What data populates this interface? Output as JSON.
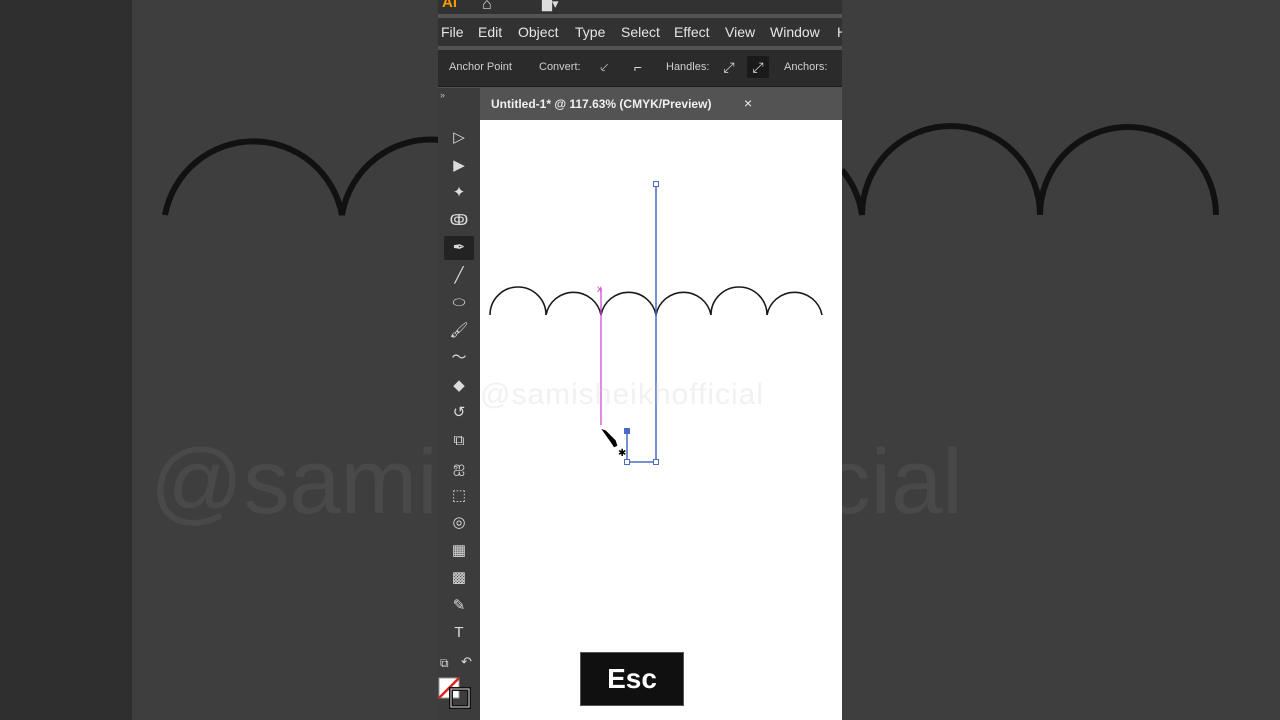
{
  "app": {
    "logo": "Ai",
    "menu": [
      "File",
      "Edit",
      "Object",
      "Type",
      "Select",
      "Effect",
      "View",
      "Window",
      "H"
    ]
  },
  "control_bar": {
    "anchor_point_label": "Anchor Point",
    "convert_label": "Convert:",
    "handles_label": "Handles:",
    "anchors_label": "Anchors:"
  },
  "document": {
    "tab_title": "Untitled-1* @ 117.63% (CMYK/Preview)",
    "close_glyph": "×"
  },
  "tools": [
    {
      "name": "selection-tool-icon",
      "glyph": "▷"
    },
    {
      "name": "direct-selection-tool-icon",
      "glyph": "▶"
    },
    {
      "name": "magic-wand-tool-icon",
      "glyph": "✦"
    },
    {
      "name": "lasso-tool-icon",
      "glyph": "ↂ"
    },
    {
      "name": "pen-tool-icon",
      "glyph": "✒",
      "active": true
    },
    {
      "name": "line-tool-icon",
      "glyph": "╱"
    },
    {
      "name": "ellipse-tool-icon",
      "glyph": "⬭"
    },
    {
      "name": "paintbrush-tool-icon",
      "glyph": "🖌"
    },
    {
      "name": "shaper-tool-icon",
      "glyph": "〜"
    },
    {
      "name": "eraser-tool-icon",
      "glyph": "◆"
    },
    {
      "name": "rotate-tool-icon",
      "glyph": "↺"
    },
    {
      "name": "scale-tool-icon",
      "glyph": "⧉"
    },
    {
      "name": "warp-tool-icon",
      "glyph": "ஐ"
    },
    {
      "name": "free-transform-tool-icon",
      "glyph": "⬚"
    },
    {
      "name": "shape-builder-tool-icon",
      "glyph": "◎"
    },
    {
      "name": "perspective-grid-tool-icon",
      "glyph": "▦"
    },
    {
      "name": "mesh-tool-icon",
      "glyph": "▩"
    },
    {
      "name": "eyedropper-tool-icon",
      "glyph": "✎"
    },
    {
      "name": "type-tool-icon",
      "glyph": "T"
    }
  ],
  "canvas": {
    "watermark": "@samisheikhofficial",
    "key_overlay": "Esc"
  },
  "colors": {
    "path_black": "#1a1a1a",
    "selected_path_blue": "#4a6cc4",
    "magenta_guide": "#d54ad5"
  }
}
